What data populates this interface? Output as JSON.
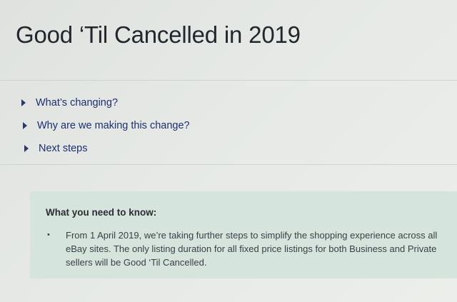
{
  "page": {
    "title": "Good ‘Til Cancelled in 2019"
  },
  "accordion": {
    "items": [
      {
        "label": "What’s changing?",
        "icon": "caret-right-icon"
      },
      {
        "label": "Why are we making this change?",
        "icon": "caret-right-icon"
      },
      {
        "label": "Next steps",
        "icon": "caret-right-icon"
      }
    ]
  },
  "notice": {
    "title": "What you need to know:",
    "bullet_glyph": "•",
    "bullets": [
      "From 1 April 2019, we’re taking further steps to simplify the shopping experience across all eBay sites. The only listing duration for all fixed price listings for both Business and Private sellers will be Good ‘Til Cancelled."
    ]
  },
  "colors": {
    "link": "#1d2f6f",
    "notice_background": "#d5e4dd",
    "title": "#23262d"
  }
}
